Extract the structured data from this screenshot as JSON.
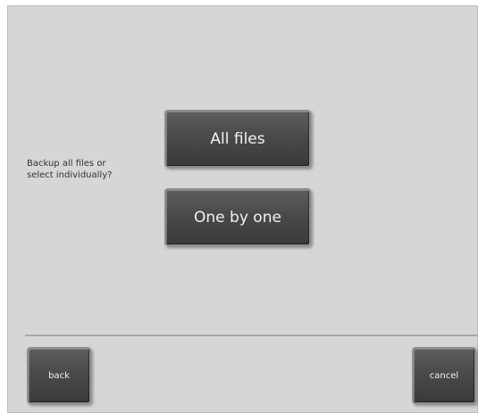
{
  "dialog": {
    "prompt_line1": "Backup all files or",
    "prompt_line2": "select individually?"
  },
  "choices": {
    "all_files_label": "All files",
    "one_by_one_label": "One by one"
  },
  "footer": {
    "back_label": "back",
    "cancel_label": "cancel"
  },
  "colors": {
    "panel_background": "#d6d6d6",
    "button_face": "#4a4a4a",
    "button_text": "#f2f2f2",
    "divider": "#a7aa9c"
  }
}
